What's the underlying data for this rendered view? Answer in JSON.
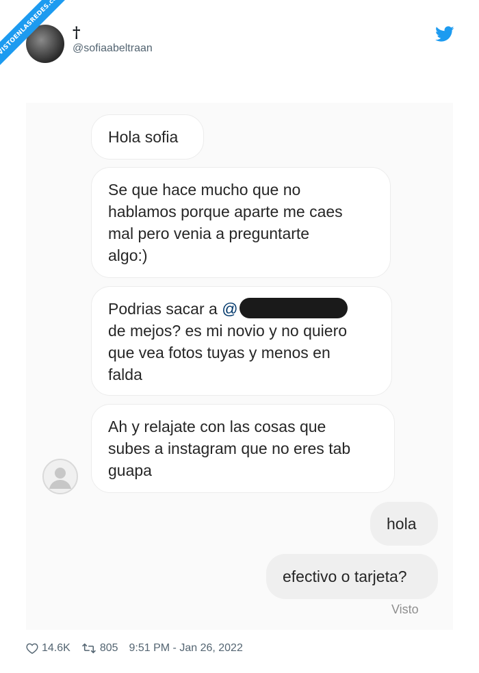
{
  "watermark": {
    "text": "VISTOENLASREDES",
    "sub": ".com"
  },
  "tweet": {
    "display_name": "†",
    "handle": "@sofiaabeltraan",
    "brand_icon": "twitter-bird-icon",
    "brand_color": "#1d9bf0"
  },
  "chat": {
    "messages": [
      {
        "side": "left",
        "text": "Hola sofia"
      },
      {
        "side": "left",
        "lines": [
          "Se que hace mucho que no",
          "hablamos porque aparte me caes",
          "mal pero venia a preguntarte",
          "algo:)"
        ]
      },
      {
        "side": "left",
        "prefix": "Podrias sacar a ",
        "mention": "@",
        "lines": [
          "de mejos? es mi novio y no quiero",
          "que vea fotos tuyas y menos en",
          "falda"
        ]
      },
      {
        "side": "left",
        "lines": [
          "Ah y relajate con las cosas que",
          "subes a instagram que no eres tab",
          "guapa"
        ]
      },
      {
        "side": "right",
        "text": "hola"
      },
      {
        "side": "right",
        "text": "efectivo o tarjeta?"
      }
    ],
    "seen_label": "Visto"
  },
  "footer": {
    "likes": "14.6K",
    "retweets": "805",
    "timestamp": "9:51 PM - Jan 26, 2022"
  }
}
